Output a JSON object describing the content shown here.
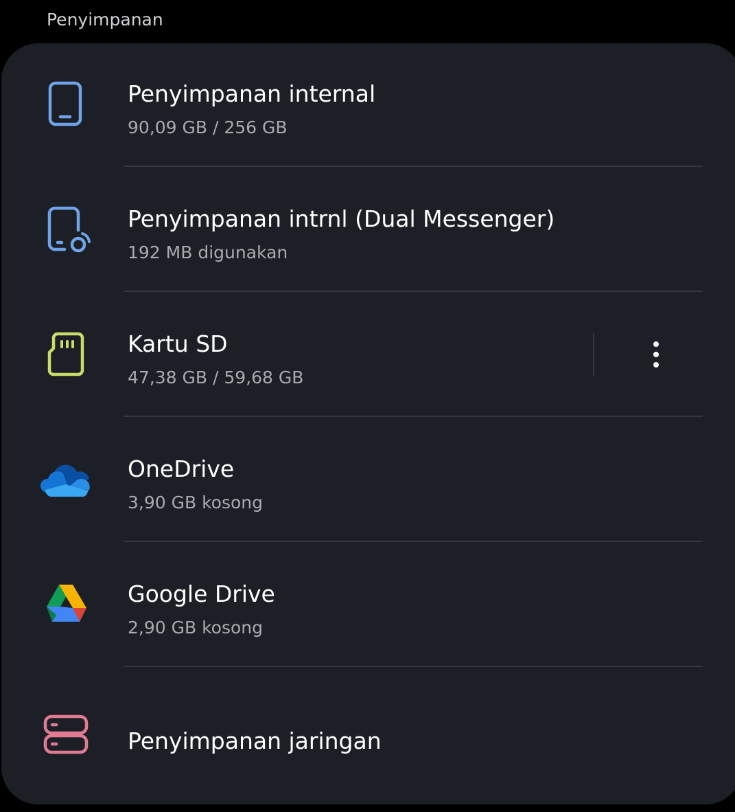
{
  "section_header": "Penyimpanan",
  "colors": {
    "card_bg": "#1c1f25",
    "internal_icon": "#6fa4e8",
    "dual_icon": "#6fa4e8",
    "sd_icon": "#c8dc6a",
    "network_icon": "#e27a94"
  },
  "items": [
    {
      "title": "Penyimpanan internal",
      "subtitle": "90,09 GB / 256 GB",
      "icon": "phone-icon"
    },
    {
      "title": "Penyimpanan intrnl (Dual Messenger)",
      "subtitle": "192 MB digunakan",
      "icon": "dual-messenger-phone-icon"
    },
    {
      "title": "Kartu SD",
      "subtitle": "47,38 GB / 59,68 GB",
      "icon": "sd-card-icon"
    },
    {
      "title": "OneDrive",
      "subtitle": "3,90 GB kosong",
      "icon": "onedrive-icon"
    },
    {
      "title": "Google Drive",
      "subtitle": "2,90 GB kosong",
      "icon": "google-drive-icon"
    },
    {
      "title": "Penyimpanan jaringan",
      "icon": "network-storage-icon"
    }
  ]
}
